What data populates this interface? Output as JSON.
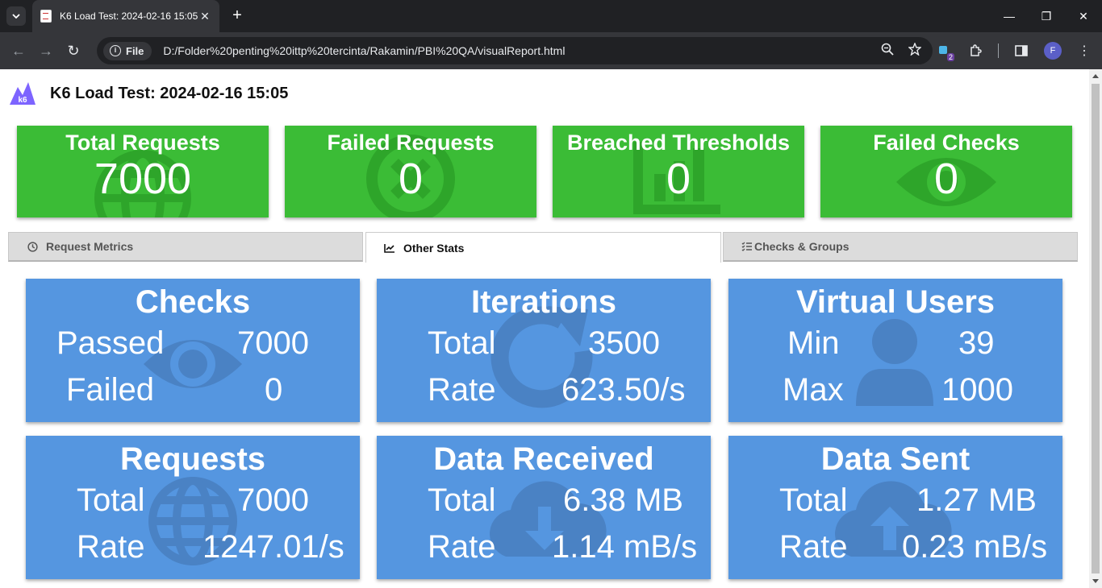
{
  "browser": {
    "tab_title": "K6 Load Test: 2024-02-16 15:05",
    "chip_label": "File",
    "url": "D:/Folder%20penting%20ittp%20tercinta/Rakamin/PBI%20QA/visualReport.html",
    "ext_badge": "2",
    "profile_initial": "F"
  },
  "header": {
    "title": "K6 Load Test: 2024-02-16 15:05",
    "logo_text": "k6"
  },
  "summary": [
    {
      "label": "Total Requests",
      "value": "7000",
      "icon": "globe-icon"
    },
    {
      "label": "Failed Requests",
      "value": "0",
      "icon": "x-circle-icon"
    },
    {
      "label": "Breached Thresholds",
      "value": "0",
      "icon": "bar-chart-icon"
    },
    {
      "label": "Failed Checks",
      "value": "0",
      "icon": "eye-icon"
    }
  ],
  "tabs": [
    {
      "label": "Request Metrics",
      "icon": "clock-icon"
    },
    {
      "label": "Other Stats",
      "icon": "line-chart-icon"
    },
    {
      "label": "Checks & Groups",
      "icon": "list-check-icon"
    }
  ],
  "stats": {
    "checks": {
      "title": "Checks",
      "r1_label": "Passed",
      "r1_value": "7000",
      "r2_label": "Failed",
      "r2_value": "0"
    },
    "iterations": {
      "title": "Iterations",
      "r1_label": "Total",
      "r1_value": "3500",
      "r2_label": "Rate",
      "r2_value": "623.50/s"
    },
    "vus": {
      "title": "Virtual Users",
      "r1_label": "Min",
      "r1_value": "39",
      "r2_label": "Max",
      "r2_value": "1000"
    },
    "requests": {
      "title": "Requests",
      "r1_label": "Total",
      "r1_value": "7000",
      "r2_label": "Rate",
      "r2_value": "1247.01/s"
    },
    "received": {
      "title": "Data Received",
      "r1_label": "Total",
      "r1_value": "6.38 MB",
      "r2_label": "Rate",
      "r2_value": "1.14 mB/s"
    },
    "sent": {
      "title": "Data Sent",
      "r1_label": "Total",
      "r1_value": "1.27 MB",
      "r2_label": "Rate",
      "r2_value": "0.23 mB/s"
    }
  },
  "colors": {
    "summary_green": "#3bbc36",
    "stat_blue": "#5596e0",
    "k6_purple": "#7d64ff"
  }
}
